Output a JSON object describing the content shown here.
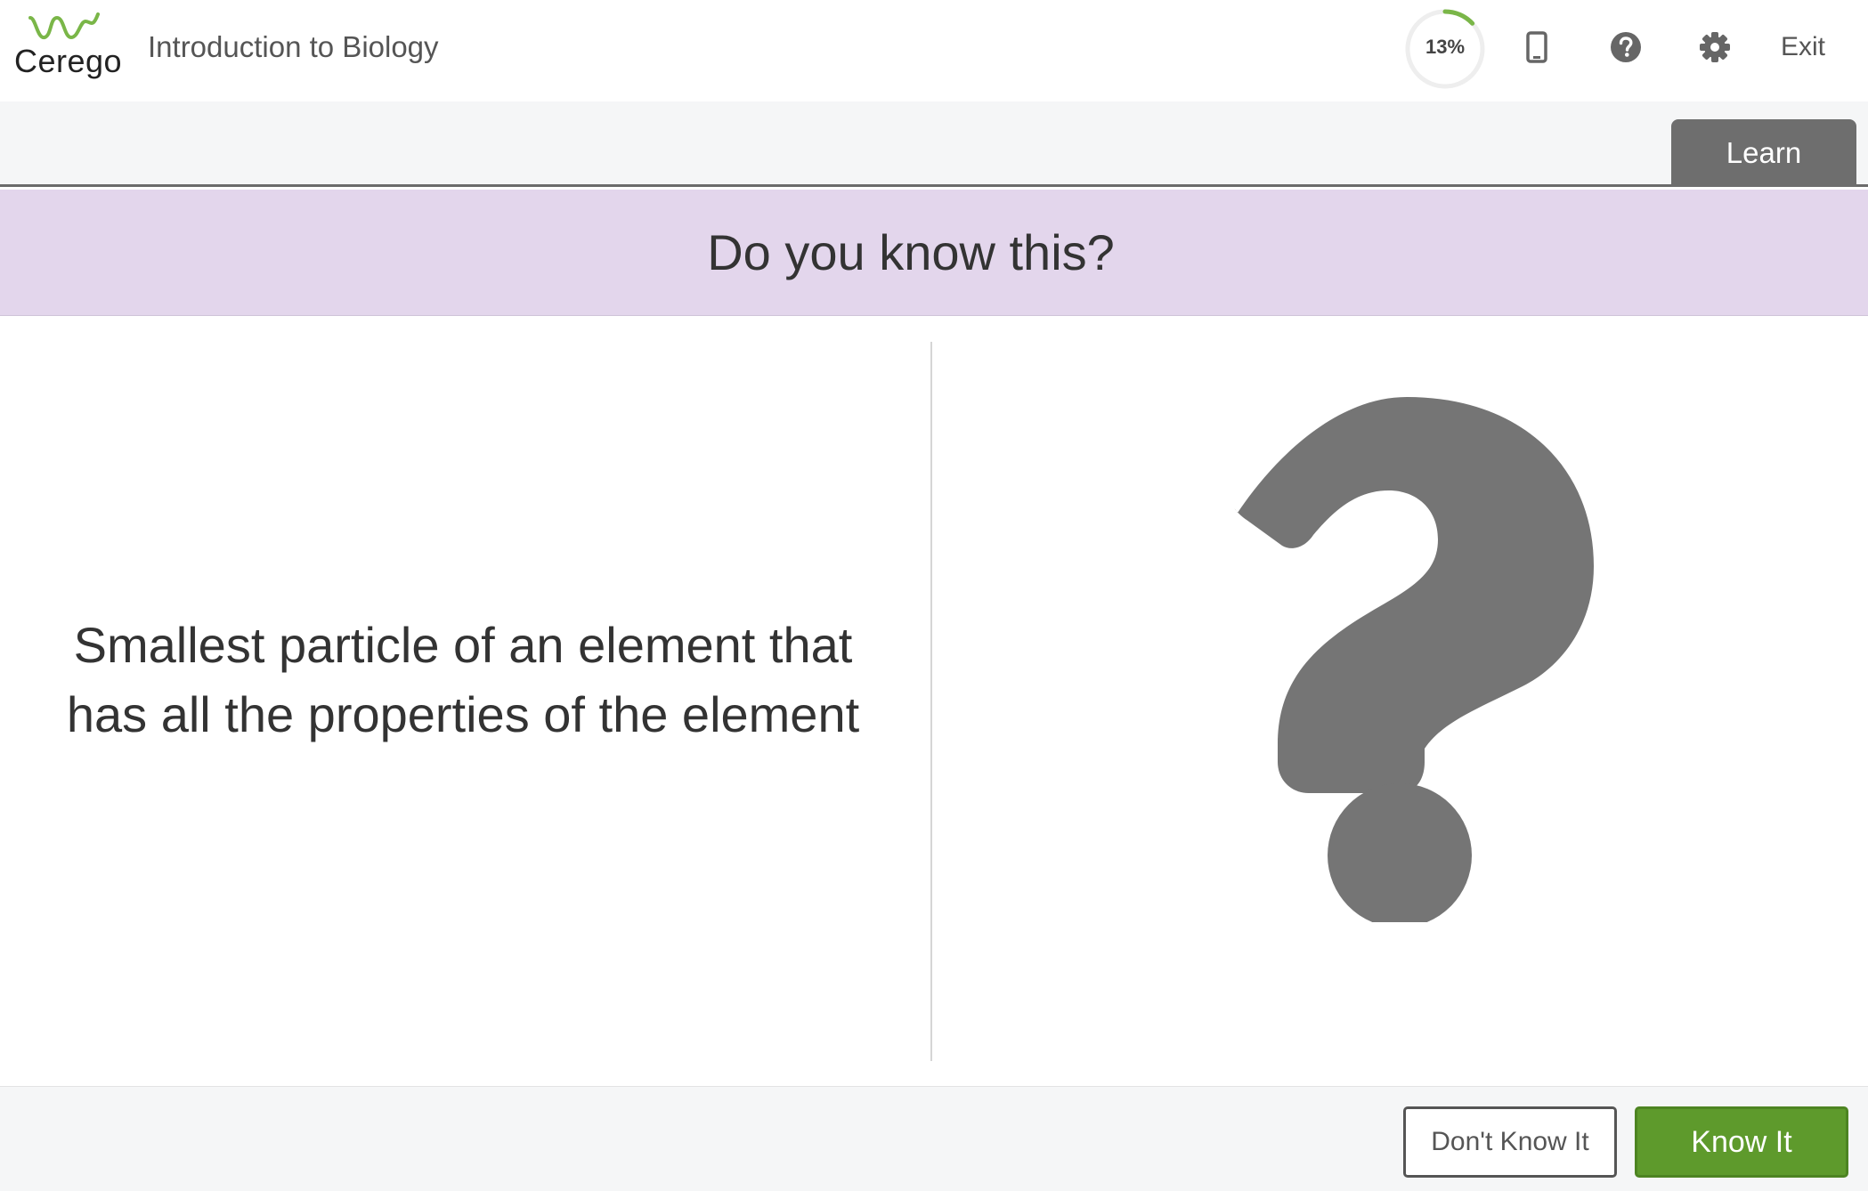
{
  "header": {
    "logo_text": "Cerego",
    "course_title": "Introduction to Biology",
    "progress_label": "13%",
    "progress_fraction": 0.13,
    "icons": [
      "cerego-wave-icon",
      "mobile-phone-icon",
      "help-icon",
      "gear-icon"
    ],
    "exit_label": "Exit"
  },
  "tabs": {
    "active_label": "Learn"
  },
  "prompt": {
    "heading": "Do you know this?"
  },
  "card": {
    "question": "Smallest particle of an element that has all the properties of the element",
    "answer_placeholder_icon": "question-mark-icon"
  },
  "actions": {
    "dont_know_label": "Don't Know It",
    "know_label": "Know It"
  },
  "colors": {
    "brand_green": "#7ab648",
    "banner_purple": "#e3d6ec",
    "know_button": "#5e9a2c",
    "tab_gray": "#6e6e6e",
    "icon_gray": "#757575"
  }
}
